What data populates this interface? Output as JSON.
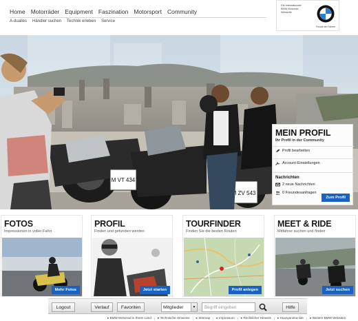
{
  "nav": {
    "main": [
      "Home",
      "Motorräder",
      "Equipment",
      "Faszination",
      "Motorsport",
      "Community"
    ],
    "sub": [
      "A-dualles",
      "Händler suchen",
      "Technik erleben",
      "Service"
    ]
  },
  "logo": {
    "text": "Die internationale BMW Motorrad Webseite",
    "caption": "Freude am Fahren",
    "icon": "bmw-roundel-icon"
  },
  "profile": {
    "title": "MEIN PROFIL",
    "subtitle": "Ihr Profil in der Community",
    "links": [
      "Profil bearbeiten",
      "Account-Einstellungen"
    ],
    "news_heading": "Nachrichten",
    "news": [
      "2 neue Nachrichten",
      "0 Freundesanfragen"
    ],
    "button": "Zum Profil"
  },
  "cards": [
    {
      "title": "FOTOS",
      "subtitle": "Impressionen in voller Fahrt",
      "button": "Mehr Fotos"
    },
    {
      "title": "PROFIL",
      "subtitle": "Finden und gefunden werden",
      "button": "Jetzt starten"
    },
    {
      "title": "TOURFINDER",
      "subtitle": "Finden Sie die besten Routen",
      "button": "Profil anlegen"
    },
    {
      "title": "MEET & RIDE",
      "subtitle": "Mitfahrer suchen und finden",
      "button": "Jetzt suchen"
    }
  ],
  "toolbar": {
    "logout": "Logout",
    "history": "Verlauf",
    "favorites": "Favoriten",
    "select_value": "Mitglieder",
    "search_placeholder": "Begriff eingeben",
    "help": "Hilfe"
  },
  "plates": [
    "M VT 434",
    "M ZV 543"
  ],
  "footer": [
    "BMW Motorrad in Ihrem Land",
    "Technische Hinweise",
    "Sitemap",
    "Impressum",
    "Rechtlicher Hinweis",
    "Huusyanima-site",
    "Weitere BMW Websites"
  ],
  "colors": {
    "accent": "#1b61c2",
    "text": "#222222"
  }
}
